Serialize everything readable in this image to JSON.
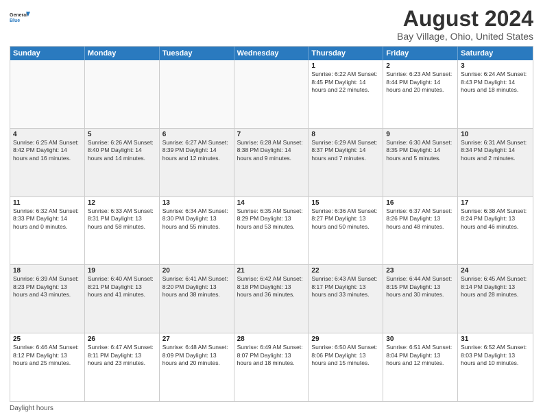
{
  "logo": {
    "line1": "General",
    "line2": "Blue"
  },
  "title": "August 2024",
  "subtitle": "Bay Village, Ohio, United States",
  "days_of_week": [
    "Sunday",
    "Monday",
    "Tuesday",
    "Wednesday",
    "Thursday",
    "Friday",
    "Saturday"
  ],
  "footer": "Daylight hours",
  "weeks": [
    [
      {
        "day": "",
        "info": "",
        "empty": true
      },
      {
        "day": "",
        "info": "",
        "empty": true
      },
      {
        "day": "",
        "info": "",
        "empty": true
      },
      {
        "day": "",
        "info": "",
        "empty": true
      },
      {
        "day": "1",
        "info": "Sunrise: 6:22 AM\nSunset: 8:45 PM\nDaylight: 14 hours\nand 22 minutes."
      },
      {
        "day": "2",
        "info": "Sunrise: 6:23 AM\nSunset: 8:44 PM\nDaylight: 14 hours\nand 20 minutes."
      },
      {
        "day": "3",
        "info": "Sunrise: 6:24 AM\nSunset: 8:43 PM\nDaylight: 14 hours\nand 18 minutes."
      }
    ],
    [
      {
        "day": "4",
        "info": "Sunrise: 6:25 AM\nSunset: 8:42 PM\nDaylight: 14 hours\nand 16 minutes.",
        "alt": true
      },
      {
        "day": "5",
        "info": "Sunrise: 6:26 AM\nSunset: 8:40 PM\nDaylight: 14 hours\nand 14 minutes.",
        "alt": true
      },
      {
        "day": "6",
        "info": "Sunrise: 6:27 AM\nSunset: 8:39 PM\nDaylight: 14 hours\nand 12 minutes.",
        "alt": true
      },
      {
        "day": "7",
        "info": "Sunrise: 6:28 AM\nSunset: 8:38 PM\nDaylight: 14 hours\nand 9 minutes.",
        "alt": true
      },
      {
        "day": "8",
        "info": "Sunrise: 6:29 AM\nSunset: 8:37 PM\nDaylight: 14 hours\nand 7 minutes.",
        "alt": true
      },
      {
        "day": "9",
        "info": "Sunrise: 6:30 AM\nSunset: 8:35 PM\nDaylight: 14 hours\nand 5 minutes.",
        "alt": true
      },
      {
        "day": "10",
        "info": "Sunrise: 6:31 AM\nSunset: 8:34 PM\nDaylight: 14 hours\nand 2 minutes.",
        "alt": true
      }
    ],
    [
      {
        "day": "11",
        "info": "Sunrise: 6:32 AM\nSunset: 8:33 PM\nDaylight: 14 hours\nand 0 minutes."
      },
      {
        "day": "12",
        "info": "Sunrise: 6:33 AM\nSunset: 8:31 PM\nDaylight: 13 hours\nand 58 minutes."
      },
      {
        "day": "13",
        "info": "Sunrise: 6:34 AM\nSunset: 8:30 PM\nDaylight: 13 hours\nand 55 minutes."
      },
      {
        "day": "14",
        "info": "Sunrise: 6:35 AM\nSunset: 8:29 PM\nDaylight: 13 hours\nand 53 minutes."
      },
      {
        "day": "15",
        "info": "Sunrise: 6:36 AM\nSunset: 8:27 PM\nDaylight: 13 hours\nand 50 minutes."
      },
      {
        "day": "16",
        "info": "Sunrise: 6:37 AM\nSunset: 8:26 PM\nDaylight: 13 hours\nand 48 minutes."
      },
      {
        "day": "17",
        "info": "Sunrise: 6:38 AM\nSunset: 8:24 PM\nDaylight: 13 hours\nand 46 minutes."
      }
    ],
    [
      {
        "day": "18",
        "info": "Sunrise: 6:39 AM\nSunset: 8:23 PM\nDaylight: 13 hours\nand 43 minutes.",
        "alt": true
      },
      {
        "day": "19",
        "info": "Sunrise: 6:40 AM\nSunset: 8:21 PM\nDaylight: 13 hours\nand 41 minutes.",
        "alt": true
      },
      {
        "day": "20",
        "info": "Sunrise: 6:41 AM\nSunset: 8:20 PM\nDaylight: 13 hours\nand 38 minutes.",
        "alt": true
      },
      {
        "day": "21",
        "info": "Sunrise: 6:42 AM\nSunset: 8:18 PM\nDaylight: 13 hours\nand 36 minutes.",
        "alt": true
      },
      {
        "day": "22",
        "info": "Sunrise: 6:43 AM\nSunset: 8:17 PM\nDaylight: 13 hours\nand 33 minutes.",
        "alt": true
      },
      {
        "day": "23",
        "info": "Sunrise: 6:44 AM\nSunset: 8:15 PM\nDaylight: 13 hours\nand 30 minutes.",
        "alt": true
      },
      {
        "day": "24",
        "info": "Sunrise: 6:45 AM\nSunset: 8:14 PM\nDaylight: 13 hours\nand 28 minutes.",
        "alt": true
      }
    ],
    [
      {
        "day": "25",
        "info": "Sunrise: 6:46 AM\nSunset: 8:12 PM\nDaylight: 13 hours\nand 25 minutes."
      },
      {
        "day": "26",
        "info": "Sunrise: 6:47 AM\nSunset: 8:11 PM\nDaylight: 13 hours\nand 23 minutes."
      },
      {
        "day": "27",
        "info": "Sunrise: 6:48 AM\nSunset: 8:09 PM\nDaylight: 13 hours\nand 20 minutes."
      },
      {
        "day": "28",
        "info": "Sunrise: 6:49 AM\nSunset: 8:07 PM\nDaylight: 13 hours\nand 18 minutes."
      },
      {
        "day": "29",
        "info": "Sunrise: 6:50 AM\nSunset: 8:06 PM\nDaylight: 13 hours\nand 15 minutes."
      },
      {
        "day": "30",
        "info": "Sunrise: 6:51 AM\nSunset: 8:04 PM\nDaylight: 13 hours\nand 12 minutes."
      },
      {
        "day": "31",
        "info": "Sunrise: 6:52 AM\nSunset: 8:03 PM\nDaylight: 13 hours\nand 10 minutes."
      }
    ]
  ]
}
